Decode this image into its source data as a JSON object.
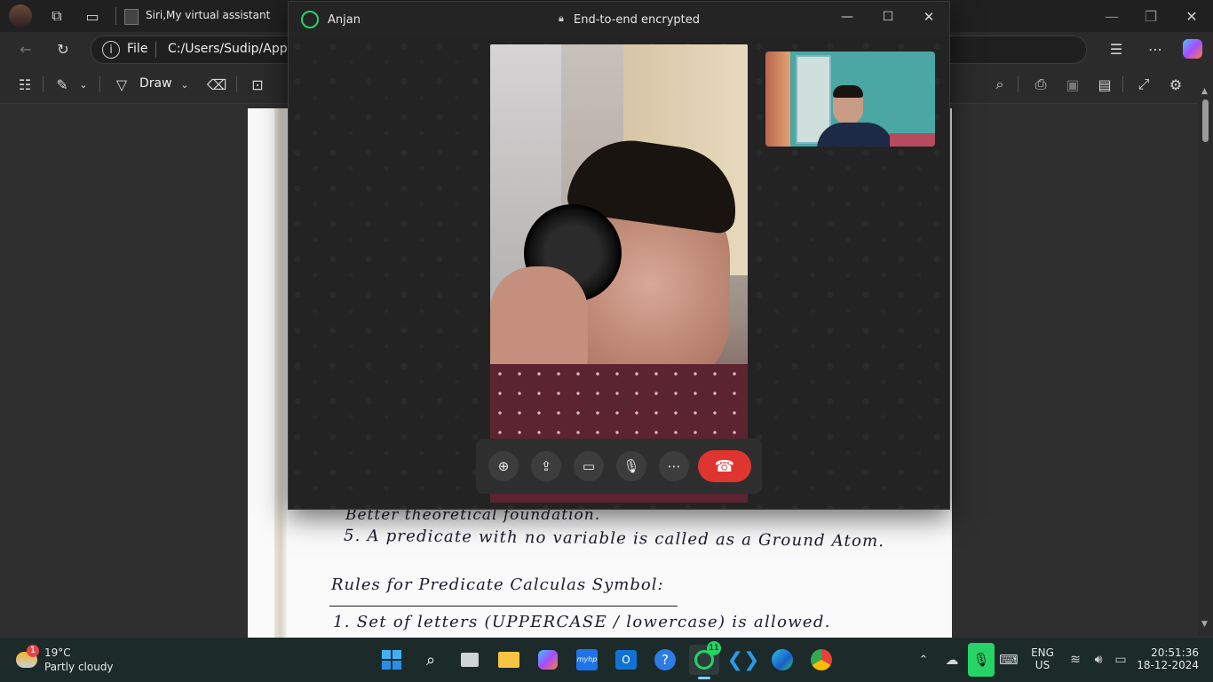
{
  "browser": {
    "tab_title": "Siri,My virtual assistant",
    "file_label": "File",
    "url": "C:/Users/Sudip/AppDa"
  },
  "pdf_toolbar": {
    "draw_label": "Draw"
  },
  "document": {
    "line_4_partial": "Better theoretical foundation.",
    "line_5": "5.  A predicate with no variable is called as a Ground Atom.",
    "heading": "Rules for Predicate Calculas Symbol:",
    "rule_1": "1. Set of letters (UPPERCASE / lowercase) is allowed."
  },
  "whatsapp": {
    "contact_name": "Anjan",
    "encryption_label": "End-to-end encrypted",
    "icons": {
      "app": "whatsapp-icon",
      "lock": "lock-icon",
      "add_person": "add-participant-icon",
      "share": "screen-share-icon",
      "video": "video-camera-icon",
      "mic": "microphone-icon",
      "more": "more-options-icon",
      "end": "end-call-icon"
    },
    "end_call_color": "#e0352f"
  },
  "taskbar": {
    "weather_temp": "19°C",
    "weather_desc": "Partly cloudy",
    "weather_badge": "1",
    "whatsapp_badge": "11",
    "lang_line1": "ENG",
    "lang_line2": "US",
    "time": "20:51:36",
    "date": "18-12-2024"
  }
}
